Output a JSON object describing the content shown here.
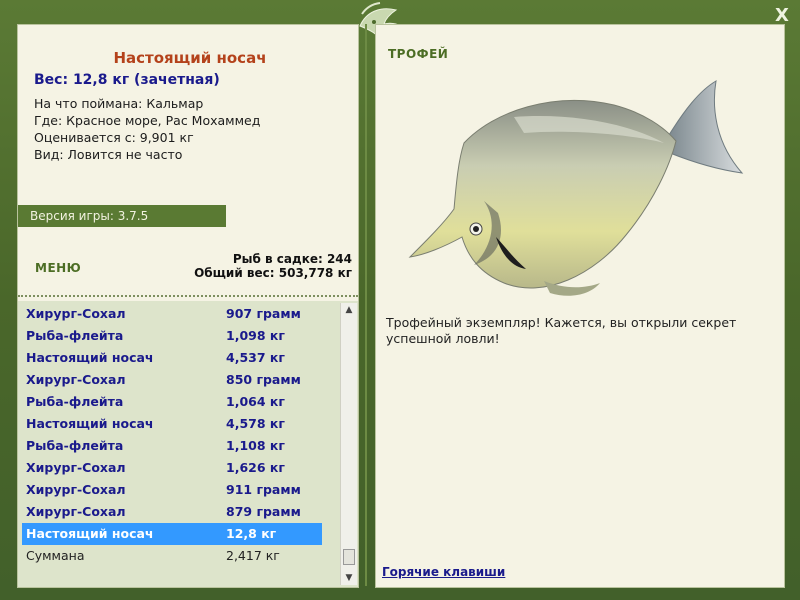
{
  "window": {
    "close_label": "X"
  },
  "catch": {
    "title": "Настоящий носач",
    "weight": "Вес: 12,8 кг (зачетная)",
    "bait": "На что поймана: Кальмар",
    "location": "Где: Красное море, Рас Мохаммед",
    "value": "Оценивается с: 9,901 кг",
    "rarity": "Вид: Ловится не часто"
  },
  "version": "Версия игры: 3.7.5",
  "menu_label": "МЕНЮ",
  "stats": {
    "fish_count": "Рыб в садке: 244",
    "total_weight": "Общий вес: 503,778 кг"
  },
  "fish_list": [
    {
      "name": "Хирург-Сохал",
      "weight": "907 грамм"
    },
    {
      "name": "Рыба-флейта",
      "weight": "1,098 кг"
    },
    {
      "name": "Настоящий носач",
      "weight": "4,537 кг"
    },
    {
      "name": "Хирург-Сохал",
      "weight": "850 грамм"
    },
    {
      "name": "Рыба-флейта",
      "weight": "1,064 кг"
    },
    {
      "name": "Настоящий носач",
      "weight": "4,578 кг"
    },
    {
      "name": "Рыба-флейта",
      "weight": "1,108 кг"
    },
    {
      "name": "Хирург-Сохал",
      "weight": "1,626 кг"
    },
    {
      "name": "Хирург-Сохал",
      "weight": "911 грамм"
    },
    {
      "name": "Хирург-Сохал",
      "weight": "879 грамм"
    },
    {
      "name": "Настоящий носач",
      "weight": "12,8 кг"
    },
    {
      "name": "Суммана",
      "weight": "2,417 кг"
    }
  ],
  "selected_index": 10,
  "trophy": {
    "label": "ТРОФЕЙ",
    "text": "Трофейный экземпляр! Кажется, вы открыли секрет успешной ловли!"
  },
  "hotkeys_label": "Горячие клавиши",
  "colors": {
    "frame": "#4d6b2c",
    "panel": "#f5f3e4",
    "title": "#b4421b",
    "link": "#1a1a8c",
    "selection": "#3399ff"
  },
  "icons": {
    "emblem": "fish-emblem-icon",
    "scroll_up": "arrow-up-icon",
    "scroll_down": "arrow-down-icon"
  }
}
